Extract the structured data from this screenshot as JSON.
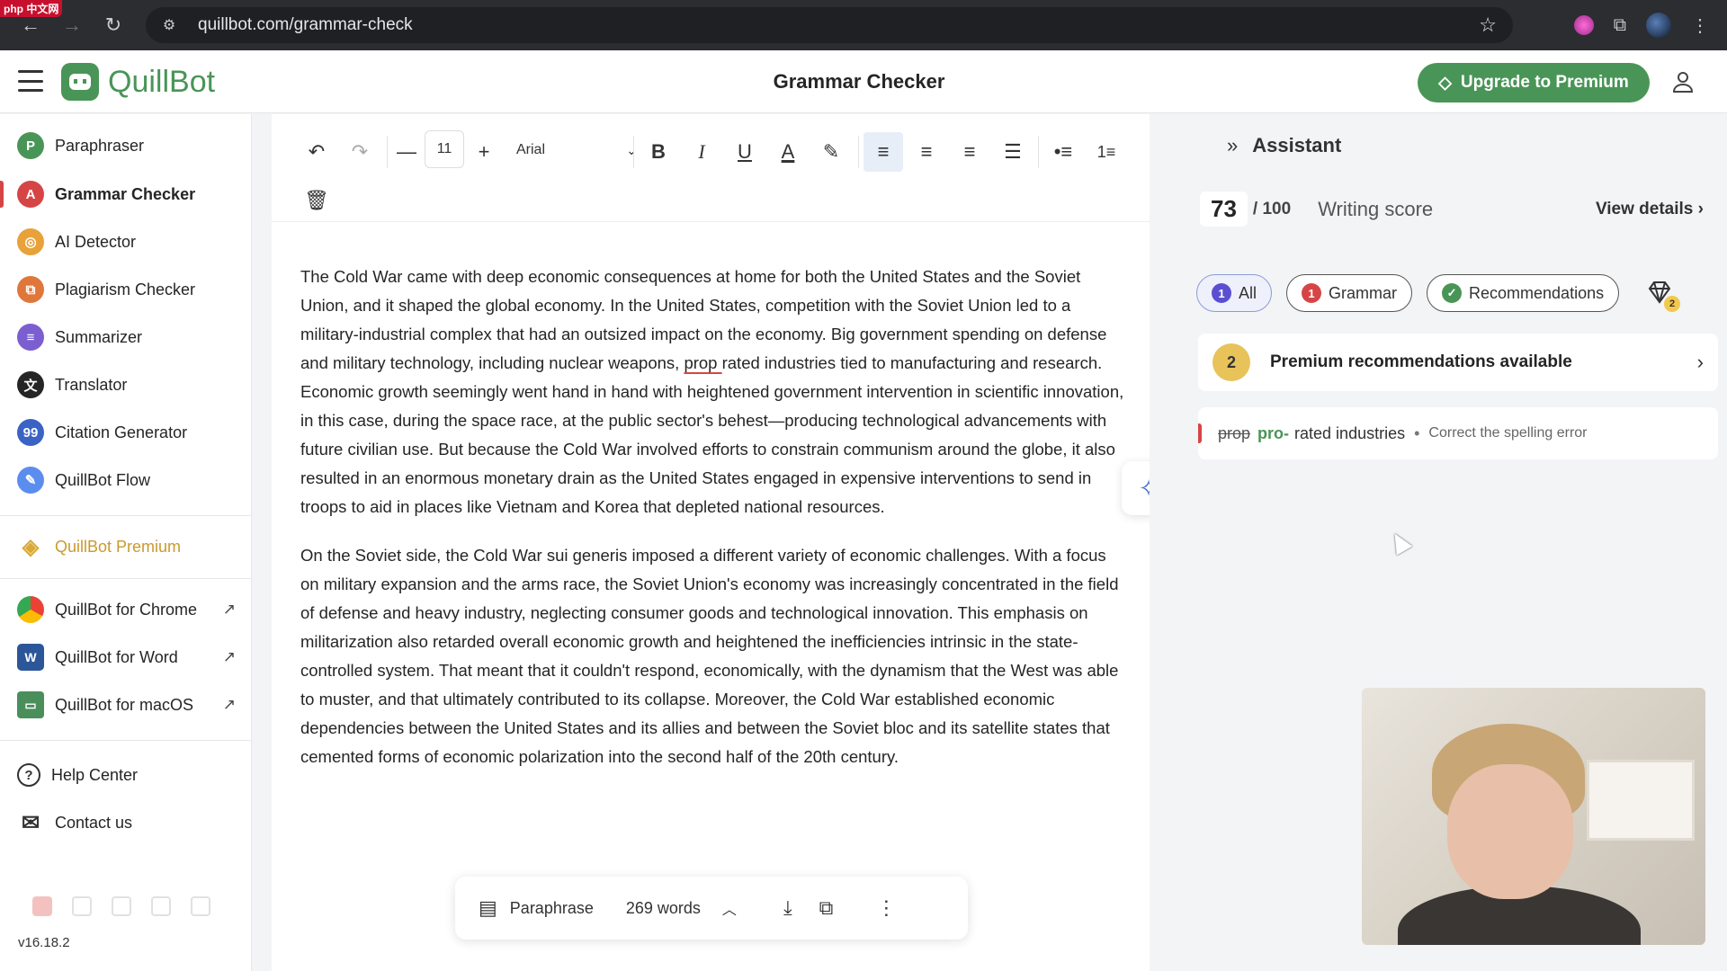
{
  "browser": {
    "url": "quillbot.com/grammar-check",
    "badge": "php 中文网"
  },
  "header": {
    "logo": "QuillBot",
    "title": "Grammar Checker",
    "upgrade_label": "Upgrade to Premium"
  },
  "sidebar": {
    "items": [
      {
        "label": "Paraphraser",
        "icon": "paraphraser-icon",
        "color": "#499557"
      },
      {
        "label": "Grammar Checker",
        "icon": "grammar-checker-icon",
        "color": "#d64545"
      },
      {
        "label": "AI Detector",
        "icon": "ai-detector-icon",
        "color": "#e8a23a"
      },
      {
        "label": "Plagiarism Checker",
        "icon": "plagiarism-checker-icon",
        "color": "#e0773a"
      },
      {
        "label": "Summarizer",
        "icon": "summarizer-icon",
        "color": "#7b5fd1"
      },
      {
        "label": "Translator",
        "icon": "translator-icon",
        "color": "#252525"
      },
      {
        "label": "Citation Generator",
        "icon": "citation-generator-icon",
        "color": "#3b63c4"
      },
      {
        "label": "QuillBot Flow",
        "icon": "flow-icon",
        "color": "#5b8def"
      }
    ],
    "premium_label": "QuillBot Premium",
    "apps": [
      {
        "label": "QuillBot for Chrome",
        "icon": "chrome-icon"
      },
      {
        "label": "QuillBot for Word",
        "icon": "word-icon"
      },
      {
        "label": "QuillBot for macOS",
        "icon": "macos-icon"
      }
    ],
    "help_label": "Help Center",
    "contact_label": "Contact us",
    "version": "v16.18.2"
  },
  "editor": {
    "font_size": "11",
    "font_family": "Arial",
    "paragraphs": [
      {
        "before": "The  Cold War came with deep economic consequences at home for both the United States and the Soviet Union, and it shaped the global economy. In the United States, competition with the  Soviet Union led to a military-industrial complex that had an outsized impact on the economy. Big government spending on defense and military technology, including nuclear weapons, ",
        "error": "prop ",
        "after": "rated industries tied  to manufacturing and research. Economic growth seemingly went hand in hand with heightened government intervention in scientific innovation, in this case, during the  space race, at the public sector's behest—producing technological advancements with future civilian use. But because the Cold War involved efforts to constrain communism around the globe, it also resulted in an enormous monetary drain as the United States engaged in expensive interventions to send in troops to aid in places like Vietnam  and Korea that depleted national resources."
      },
      {
        "text": "On the Soviet side,  the Cold War sui generis imposed a different variety of economic challenges. With a focus on military expansion and the arms race, the Soviet Union's  economy was increasingly concentrated in the field of defense and heavy industry, neglecting consumer goods and technological innovation. This emphasis on militarization also retarded overall economic growth and  heightened the inefficiencies intrinsic in the state-controlled system. That meant that it couldn't respond, economically, with the dynamism that the West was able to muster,  and that ultimately contributed to its collapse. Moreover, the Cold War established economic dependencies between the United  States and its allies and between the Soviet bloc and its satellite states that cemented forms of economic polarization into the second half of the 20th century."
      }
    ],
    "bottom_bar": {
      "paraphrase_label": "Paraphrase",
      "word_count": "269 words"
    }
  },
  "assistant": {
    "title": "Assistant",
    "score": "73",
    "score_max": "/  100",
    "score_label": "Writing score",
    "view_details": "View details",
    "filters": [
      {
        "count": "1",
        "label": "All",
        "color": "#5b4fd1"
      },
      {
        "count": "1",
        "label": "Grammar",
        "color": "#d64545"
      },
      {
        "label": "Recommendations",
        "color": "#499557"
      }
    ],
    "premium_count": "2",
    "premium_text": "Premium recommendations available",
    "suggestion": {
      "old": "prop",
      "new": "pro-",
      "rest": "rated industries",
      "hint": "Correct the spelling error"
    }
  }
}
